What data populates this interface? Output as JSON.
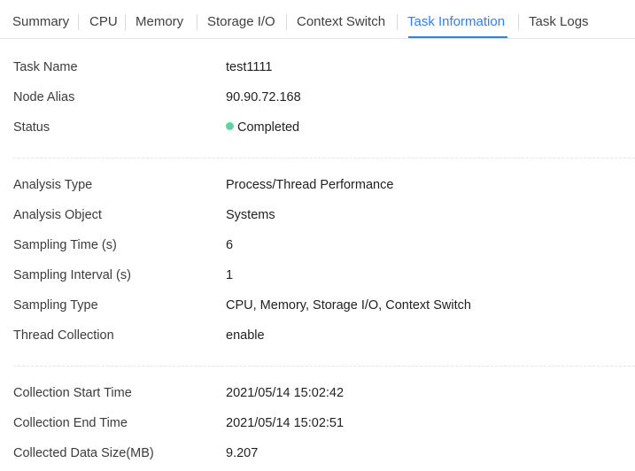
{
  "tabs": [
    {
      "label": "Summary",
      "active": false
    },
    {
      "label": "CPU",
      "active": false
    },
    {
      "label": "Memory",
      "active": false
    },
    {
      "label": "Storage I/O",
      "active": false
    },
    {
      "label": "Context Switch",
      "active": false
    },
    {
      "label": "Task Information",
      "active": true
    },
    {
      "label": "Task Logs",
      "active": false
    }
  ],
  "colors": {
    "accent": "#2a7fff",
    "status_completed": "#5cd6a1"
  },
  "basic_info": {
    "task_name": {
      "label": "Task Name",
      "value": "test1111"
    },
    "node_alias": {
      "label": "Node Alias",
      "value": "90.90.72.168"
    },
    "status": {
      "label": "Status",
      "value": "Completed",
      "icon": "status-dot-icon"
    }
  },
  "analysis_info": {
    "analysis_type": {
      "label": "Analysis Type",
      "value": "Process/Thread Performance"
    },
    "analysis_object": {
      "label": "Analysis Object",
      "value": "Systems"
    },
    "sampling_time": {
      "label": "Sampling Time (s)",
      "value": "6"
    },
    "sampling_interval": {
      "label": "Sampling Interval (s)",
      "value": "1"
    },
    "sampling_type": {
      "label": "Sampling Type",
      "value": "CPU, Memory, Storage I/O, Context Switch"
    },
    "thread_collection": {
      "label": "Thread Collection",
      "value": "enable"
    }
  },
  "collection_info": {
    "start_time": {
      "label": "Collection Start Time",
      "value": "2021/05/14 15:02:42"
    },
    "end_time": {
      "label": "Collection End Time",
      "value": "2021/05/14 15:02:51"
    },
    "data_size": {
      "label": "Collected Data Size(MB)",
      "value": "9.207"
    }
  }
}
